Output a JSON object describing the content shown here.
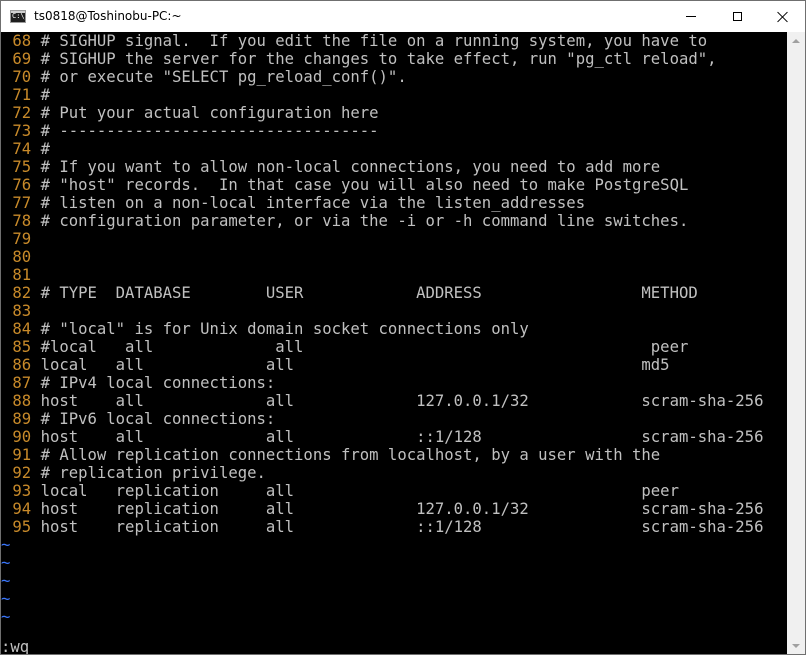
{
  "window": {
    "title": "ts0818@Toshinobu-PC:~",
    "icon_label": "C:\\_"
  },
  "terminal": {
    "lines": [
      {
        "num": "68",
        "text": "# SIGHUP signal.  If you edit the file on a running system, you have to"
      },
      {
        "num": "69",
        "text": "# SIGHUP the server for the changes to take effect, run \"pg_ctl reload\","
      },
      {
        "num": "70",
        "text": "# or execute \"SELECT pg_reload_conf()\"."
      },
      {
        "num": "71",
        "text": "#"
      },
      {
        "num": "72",
        "text": "# Put your actual configuration here"
      },
      {
        "num": "73",
        "text": "# ----------------------------------"
      },
      {
        "num": "74",
        "text": "#"
      },
      {
        "num": "75",
        "text": "# If you want to allow non-local connections, you need to add more"
      },
      {
        "num": "76",
        "text": "# \"host\" records.  In that case you will also need to make PostgreSQL"
      },
      {
        "num": "77",
        "text": "# listen on a non-local interface via the listen_addresses"
      },
      {
        "num": "78",
        "text": "# configuration parameter, or via the -i or -h command line switches."
      },
      {
        "num": "79",
        "text": ""
      },
      {
        "num": "80",
        "text": ""
      },
      {
        "num": "81",
        "text": ""
      },
      {
        "num": "82",
        "text": "# TYPE  DATABASE        USER            ADDRESS                 METHOD"
      },
      {
        "num": "83",
        "text": ""
      },
      {
        "num": "84",
        "text": "# \"local\" is for Unix domain socket connections only"
      },
      {
        "num": "85",
        "text": "#local   all             all                                     peer"
      },
      {
        "num": "86",
        "text": "local   all             all                                     md5"
      },
      {
        "num": "87",
        "text": "# IPv4 local connections:"
      },
      {
        "num": "88",
        "text": "host    all             all             127.0.0.1/32            scram-sha-256"
      },
      {
        "num": "89",
        "text": "# IPv6 local connections:"
      },
      {
        "num": "90",
        "text": "host    all             all             ::1/128                 scram-sha-256"
      },
      {
        "num": "91",
        "text": "# Allow replication connections from localhost, by a user with the"
      },
      {
        "num": "92",
        "text": "# replication privilege."
      },
      {
        "num": "93",
        "text": "local   replication     all                                     peer"
      },
      {
        "num": "94",
        "text": "host    replication     all             127.0.0.1/32            scram-sha-256"
      },
      {
        "num": "95",
        "text": "host    replication     all             ::1/128                 scram-sha-256"
      }
    ],
    "tilde": "~",
    "tilde_count": 5,
    "command_line": ":wq"
  },
  "colors": {
    "background": "#000000",
    "text": "#c0c0c0",
    "line_number": "#c88a2a",
    "tilde": "#3b78ff"
  }
}
